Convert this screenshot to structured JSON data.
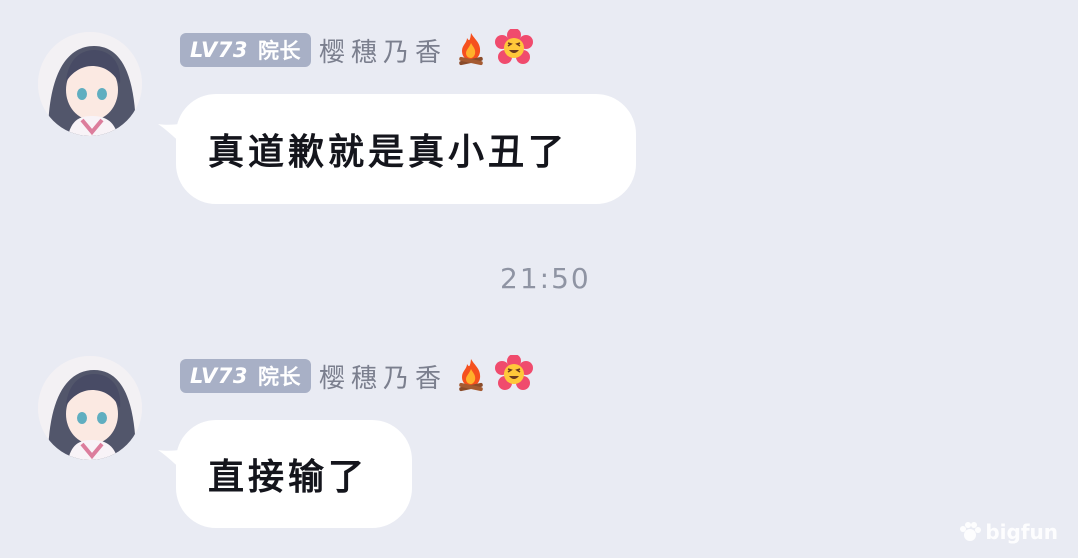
{
  "messages": [
    {
      "level": "LV73",
      "title": "院长",
      "username": "樱穗乃香",
      "badge_icons": [
        "campfire-icon",
        "smiling-flower-icon"
      ],
      "text": "真道歉就是真小丑了"
    },
    {
      "level": "LV73",
      "title": "院长",
      "username": "樱穗乃香",
      "badge_icons": [
        "campfire-icon",
        "smiling-flower-icon"
      ],
      "text": "直接输了"
    }
  ],
  "timestamp": "21:50",
  "watermark": "bigfun",
  "colors": {
    "background": "#e9ebf3",
    "bubble": "#ffffff",
    "level_badge": "#a8b0c6",
    "username": "#7b7f8e",
    "timestamp": "#8f94a3"
  }
}
